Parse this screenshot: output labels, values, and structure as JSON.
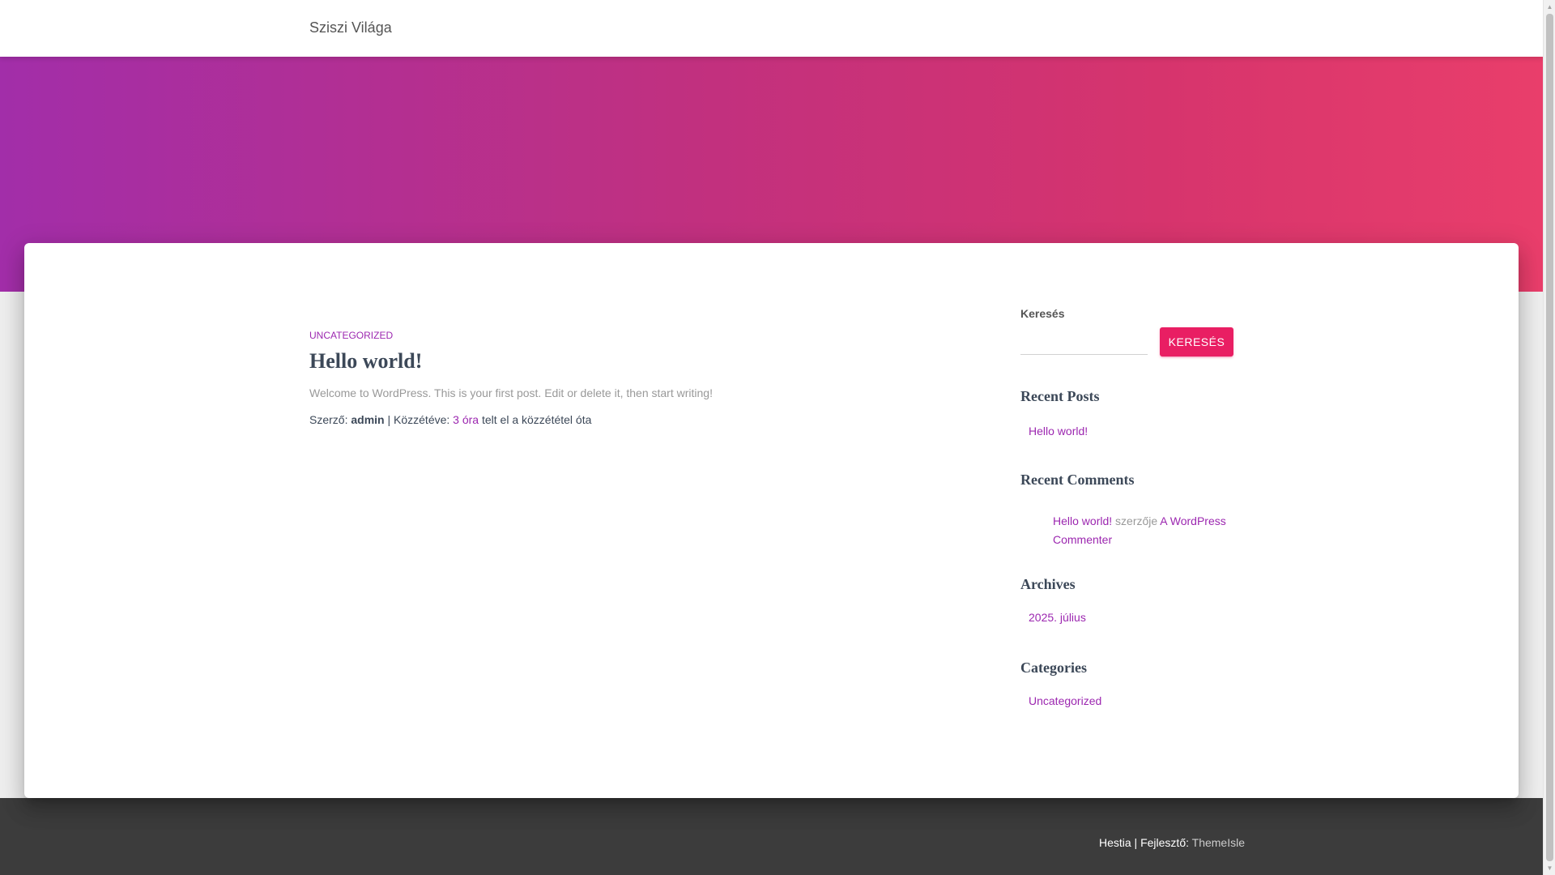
{
  "site": {
    "title": "Sziszi Világa"
  },
  "post": {
    "category": "UNCATEGORIZED",
    "title": "Hello world!",
    "excerpt": "Welcome to WordPress. This is your first post. Edit or delete it, then start writing!",
    "meta": {
      "author_prefix": "Szerző:",
      "author": "admin",
      "separator": "|",
      "published_prefix": "Közzétéve:",
      "time_amount": "3 óra",
      "time_suffix": "telt el a közzététel óta"
    }
  },
  "sidebar": {
    "search": {
      "label": "Keresés",
      "placeholder": "",
      "button_label": "KERESÉS"
    },
    "recent_posts": {
      "title": "Recent Posts",
      "items": [
        "Hello world!"
      ]
    },
    "recent_comments": {
      "title": "Recent Comments",
      "post_link": "Hello world!",
      "connector": "szerzője",
      "author_link": "A WordPress Commenter"
    },
    "archives": {
      "title": "Archives",
      "items": [
        "2025. július"
      ]
    },
    "categories": {
      "title": "Categories",
      "items": [
        "Uncategorized"
      ]
    }
  },
  "footer": {
    "theme": "Hestia",
    "separator": "|",
    "developer_prefix": "Fejlesztő:",
    "developer": "ThemeIsle"
  },
  "colors": {
    "accent_purple": "#9c27b0",
    "accent_pink": "#e91e63",
    "hero_gradient_start": "#a22ea9",
    "hero_gradient_end": "#e93e6b",
    "footer_bg": "#3c3c3c"
  },
  "icons": {
    "scroll_up": "scroll-up-arrow-icon",
    "scroll_down": "scroll-down-arrow-icon"
  }
}
